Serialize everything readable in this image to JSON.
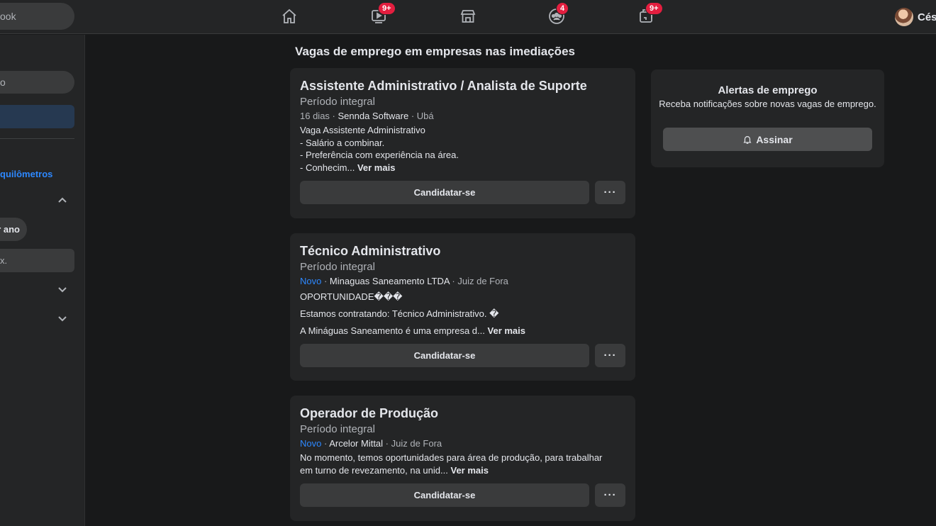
{
  "topbar": {
    "search_text": "ook",
    "nav": [
      {
        "name": "home",
        "badge": ""
      },
      {
        "name": "watch",
        "badge": "9+"
      },
      {
        "name": "marketplace",
        "badge": ""
      },
      {
        "name": "groups",
        "badge": "4"
      },
      {
        "name": "gaming",
        "badge": "9+"
      }
    ],
    "profile_name": "Césa"
  },
  "sidebar": {
    "search_value": "o",
    "distance_link": "quilômetros",
    "chip_label": "r ano",
    "input_placeholder": "x."
  },
  "feed": {
    "title": "Vagas de emprego em empresas nas imediações",
    "apply_label": "Candidatar-se",
    "more_options_label": "···",
    "see_more_label": "Ver mais",
    "jobs": [
      {
        "title": "Assistente Administrativo / Analista de Suporte",
        "type": "Período integral",
        "posted": "16 dias",
        "company": "Sennda Software",
        "location": "Ubá",
        "description_lines": [
          "Vaga Assistente Administrativo",
          "- Salário a combinar.",
          "- Preferência com experiência na área.",
          "- Conhecim..."
        ]
      },
      {
        "title": "Técnico Administrativo",
        "type": "Período integral",
        "posted": "Novo",
        "company": "Minaguas Saneamento LTDA",
        "location": "Juiz de Fora",
        "description_lines": [
          "OPORTUNIDADE���",
          "Estamos contratando: Técnico Administrativo. �",
          "A Mináguas Saneamento é uma empresa d..."
        ]
      },
      {
        "title": "Operador de Produção",
        "type": "Período integral",
        "posted": "Novo",
        "company": "Arcelor Mittal",
        "location": "Juiz de Fora",
        "description_lines": [
          "No momento, temos oportunidades para área de produção, para trabalhar",
          "em turno de revezamento, na unid..."
        ]
      }
    ]
  },
  "alerts": {
    "title": "Alertas de emprego",
    "subtitle": "Receba notificações sobre novas vagas de emprego.",
    "button_label": "Assinar"
  },
  "colors": {
    "background": "#18191a",
    "surface": "#242526",
    "button": "#3a3b3c",
    "accent": "#2d88ff",
    "badge": "#e41e3f"
  }
}
